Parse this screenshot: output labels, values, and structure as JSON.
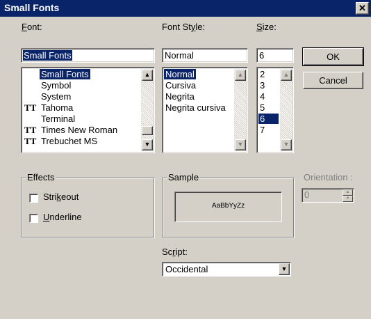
{
  "window": {
    "title": "Small Fonts",
    "close_glyph": "✕"
  },
  "font": {
    "label_accel": "F",
    "label_rest": "ont:",
    "value": "Small Fonts",
    "items": [
      {
        "name": "Small Fonts",
        "truetype": false,
        "selected": true
      },
      {
        "name": "Symbol",
        "truetype": false,
        "selected": false
      },
      {
        "name": "System",
        "truetype": false,
        "selected": false
      },
      {
        "name": "Tahoma",
        "truetype": true,
        "selected": false
      },
      {
        "name": "Terminal",
        "truetype": false,
        "selected": false
      },
      {
        "name": "Times New Roman",
        "truetype": true,
        "selected": false
      },
      {
        "name": "Trebuchet MS",
        "truetype": true,
        "selected": false
      }
    ],
    "scroll_position": 0.92
  },
  "font_style": {
    "label_pre": "Font St",
    "label_accel": "y",
    "label_post": "le:",
    "value": "Normal",
    "items": [
      {
        "name": "Normal",
        "selected": true
      },
      {
        "name": "Cursiva",
        "selected": false
      },
      {
        "name": "Negrita",
        "selected": false
      },
      {
        "name": "Negrita cursiva",
        "selected": false
      }
    ]
  },
  "size": {
    "label_accel": "S",
    "label_rest": "ize:",
    "value": "6",
    "items": [
      {
        "name": "2",
        "selected": false
      },
      {
        "name": "3",
        "selected": false
      },
      {
        "name": "4",
        "selected": false
      },
      {
        "name": "5",
        "selected": false
      },
      {
        "name": "6",
        "selected": true
      },
      {
        "name": "7",
        "selected": false
      }
    ]
  },
  "buttons": {
    "ok": "OK",
    "cancel": "Cancel"
  },
  "effects": {
    "title": "Effects",
    "strikeout": {
      "pre": "Stri",
      "accel": "k",
      "post": "eout",
      "checked": false
    },
    "underline": {
      "pre": "",
      "accel": "U",
      "post": "nderline",
      "checked": false
    }
  },
  "sample": {
    "title": "Sample",
    "text": "AaBbYyZz"
  },
  "orientation": {
    "label": "Orientation :",
    "value": "0"
  },
  "script": {
    "label_pre": "Sc",
    "label_accel": "r",
    "label_post": "ipt:",
    "value": "Occidental"
  },
  "icons": {
    "truetype": "TT",
    "arrow_up": "▲",
    "arrow_down": "▼"
  }
}
